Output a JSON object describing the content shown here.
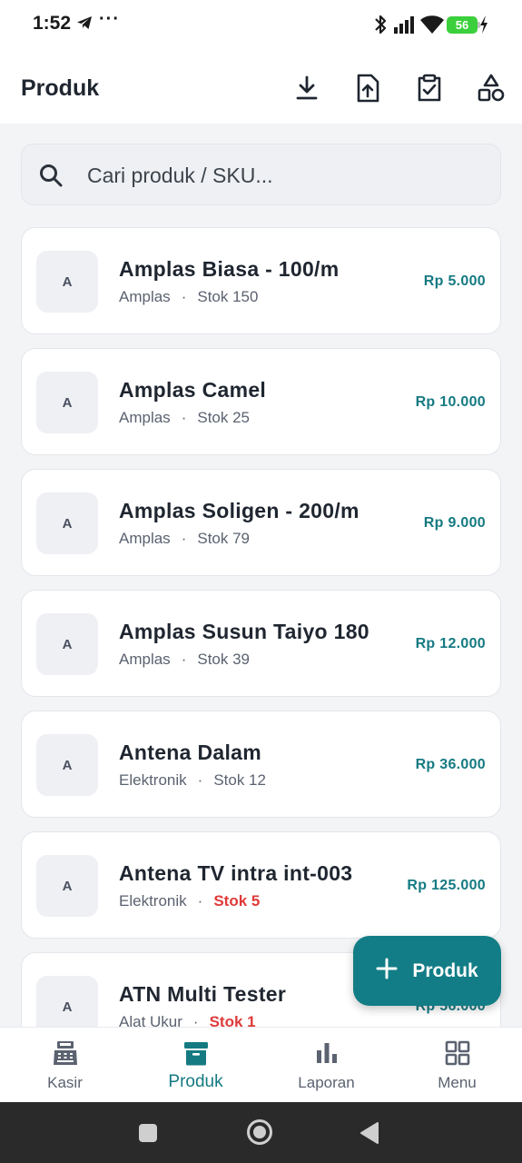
{
  "status_bar": {
    "time": "1:52",
    "dots": "···",
    "battery": "56"
  },
  "app_bar": {
    "title": "Produk",
    "actions": [
      "download-icon",
      "upload-icon",
      "clipboard-check-icon",
      "shapes-icon"
    ]
  },
  "search": {
    "placeholder": "Cari produk / SKU..."
  },
  "products": [
    {
      "initial": "A",
      "name": "Amplas Biasa - 100/m",
      "category": "Amplas",
      "stock": "Stok 150",
      "low": false,
      "price": "Rp 5.000"
    },
    {
      "initial": "A",
      "name": "Amplas Camel",
      "category": "Amplas",
      "stock": "Stok 25",
      "low": false,
      "price": "Rp 10.000"
    },
    {
      "initial": "A",
      "name": "Amplas Soligen - 200/m",
      "category": "Amplas",
      "stock": "Stok 79",
      "low": false,
      "price": "Rp 9.000"
    },
    {
      "initial": "A",
      "name": "Amplas Susun Taiyo 180",
      "category": "Amplas",
      "stock": "Stok 39",
      "low": false,
      "price": "Rp 12.000"
    },
    {
      "initial": "A",
      "name": "Antena Dalam",
      "category": "Elektronik",
      "stock": "Stok 12",
      "low": false,
      "price": "Rp 36.000"
    },
    {
      "initial": "A",
      "name": "Antena TV intra int-003",
      "category": "Elektronik",
      "stock": "Stok 5",
      "low": true,
      "price": "Rp 125.000"
    },
    {
      "initial": "A",
      "name": "ATN Multi Tester",
      "category": "Alat Ukur",
      "stock": "Stok 1",
      "low": true,
      "price": "Rp 56.000"
    }
  ],
  "fab": {
    "label": "Produk"
  },
  "bottom_nav": {
    "items": [
      {
        "label": "Kasir",
        "icon": "cash-register-icon",
        "active": false
      },
      {
        "label": "Produk",
        "icon": "archive-box-icon",
        "active": true
      },
      {
        "label": "Laporan",
        "icon": "bar-chart-icon",
        "active": false
      },
      {
        "label": "Menu",
        "icon": "grid-icon",
        "active": false
      }
    ]
  },
  "colors": {
    "accent": "#127d86",
    "price": "#157a82",
    "low_stock": "#e03a3a",
    "background": "#f3f4f6"
  }
}
